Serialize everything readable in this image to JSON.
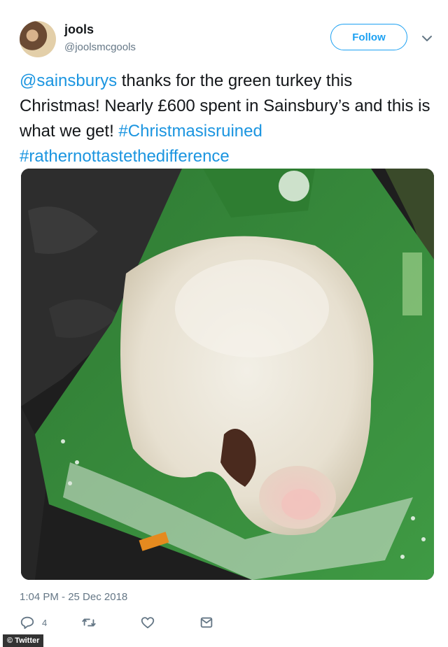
{
  "tweet": {
    "display_name": "jools",
    "handle": "@joolsmcgools",
    "follow_label": "Follow",
    "text_parts": [
      {
        "text": "@sainsburys",
        "type": "mention"
      },
      {
        "text": " thanks for the green turkey this Christmas! Nearly £600 spent in Sainsbury’s and this is what we get! ",
        "type": "plain"
      },
      {
        "text": "#Christmasisruined",
        "type": "hashtag"
      },
      {
        "text": " ",
        "type": "plain"
      },
      {
        "text": "#rathernottastethedifference",
        "type": "hashtag"
      }
    ],
    "timestamp": "1:04 PM - 25 Dec 2018",
    "reply_count": "4"
  },
  "icons": {
    "caret": "chevron-down-icon",
    "reply": "reply-icon",
    "retweet": "retweet-icon",
    "like": "heart-icon",
    "dm": "envelope-icon"
  },
  "credit": "© Twitter",
  "colors": {
    "link": "#1b95e0",
    "follow_accent": "#1da1f2",
    "muted": "#657786",
    "bag_green": "#3c8a3f"
  }
}
